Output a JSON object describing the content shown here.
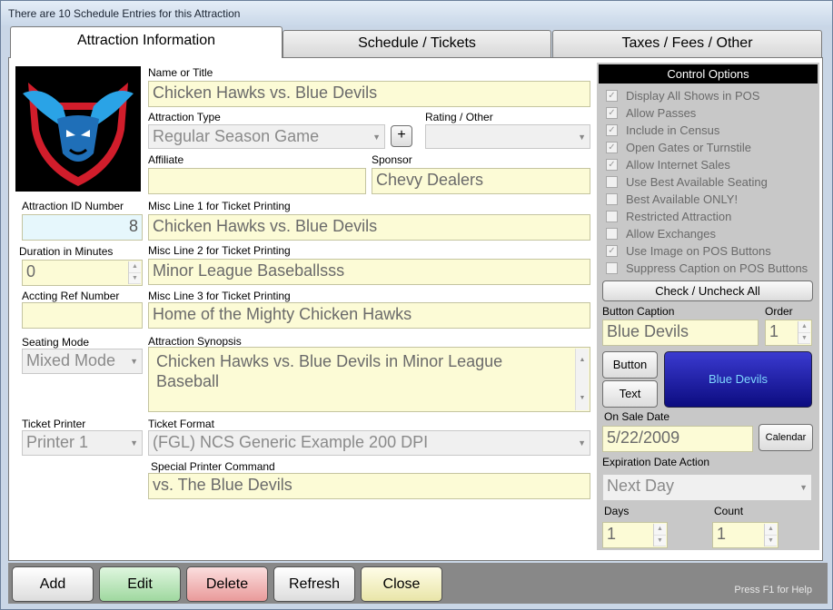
{
  "window": {
    "title": "There are 10 Schedule Entries for this Attraction"
  },
  "tabs": [
    {
      "label": "Attraction Information",
      "active": true
    },
    {
      "label": "Schedule / Tickets",
      "active": false
    },
    {
      "label": "Taxes / Fees / Other",
      "active": false
    }
  ],
  "form": {
    "name": {
      "label": "Name or Title",
      "value": "Chicken Hawks vs. Blue Devils"
    },
    "attraction_type": {
      "label": "Attraction Type",
      "value": "Regular Season Game",
      "add_label": "+"
    },
    "rating": {
      "label": "Rating / Other",
      "value": ""
    },
    "affiliate": {
      "label": "Affiliate",
      "value": ""
    },
    "sponsor": {
      "label": "Sponsor",
      "value": "Chevy Dealers"
    },
    "attraction_id": {
      "label": "Attraction ID Number",
      "value": "8"
    },
    "misc1": {
      "label": "Misc Line 1 for Ticket Printing",
      "value": "Chicken Hawks vs. Blue Devils"
    },
    "duration": {
      "label": "Duration in Minutes",
      "value": "0"
    },
    "misc2": {
      "label": "Misc Line 2 for Ticket Printing",
      "value": "Minor League Baseballsss"
    },
    "accting_ref": {
      "label": "Accting Ref Number",
      "value": ""
    },
    "misc3": {
      "label": "Misc Line 3 for Ticket Printing",
      "value": "Home of the Mighty Chicken Hawks"
    },
    "seating_mode": {
      "label": "Seating Mode",
      "value": "Mixed Mode"
    },
    "synopsis": {
      "label": "Attraction Synopsis",
      "value": "Chicken Hawks vs. Blue Devils in Minor League Baseball"
    },
    "ticket_printer": {
      "label": "Ticket Printer",
      "value": "Printer 1"
    },
    "ticket_format": {
      "label": "Ticket Format",
      "value": "(FGL) NCS Generic Example 200 DPI"
    },
    "special_cmd": {
      "label": "Special Printer Command",
      "value": "vs. The Blue Devils"
    }
  },
  "control_options": {
    "title": "Control Options",
    "options": [
      {
        "label": "Display All Shows in POS",
        "checked": true
      },
      {
        "label": "Allow Passes",
        "checked": true
      },
      {
        "label": "Include in Census",
        "checked": true
      },
      {
        "label": "Open Gates or Turnstile",
        "checked": true
      },
      {
        "label": "Allow Internet Sales",
        "checked": true
      },
      {
        "label": "Use Best Available Seating",
        "checked": false
      },
      {
        "label": "Best Available ONLY!",
        "checked": false
      },
      {
        "label": "Restricted Attraction",
        "checked": false
      },
      {
        "label": "Allow Exchanges",
        "checked": false
      },
      {
        "label": "Use Image on POS Buttons",
        "checked": true
      },
      {
        "label": "Suppress Caption on POS Buttons",
        "checked": false
      }
    ],
    "check_all_label": "Check / Uncheck All",
    "button_caption": {
      "label": "Button Caption",
      "value": "Blue Devils"
    },
    "order": {
      "label": "Order",
      "value": "1"
    },
    "button_label": "Button",
    "text_label": "Text",
    "preview": {
      "text": "Blue Devils",
      "color": "#1a1aa0"
    },
    "on_sale_date": {
      "label": "On Sale Date",
      "value": "5/22/2009"
    },
    "calendar_label": "Calendar",
    "expiration": {
      "label": "Expiration Date Action",
      "value": "Next Day"
    },
    "days": {
      "label": "Days",
      "value": "1"
    },
    "count": {
      "label": "Count",
      "value": "1"
    }
  },
  "bottom": {
    "buttons": [
      {
        "label": "Add",
        "color": "#f0f0f0"
      },
      {
        "label": "Edit",
        "color": "#b9e6b9"
      },
      {
        "label": "Delete",
        "color": "#f3b3b3"
      },
      {
        "label": "Refresh",
        "color": "#eeeeee"
      },
      {
        "label": "Close",
        "color": "#f3f0c0"
      }
    ],
    "help": "Press F1 for Help"
  }
}
